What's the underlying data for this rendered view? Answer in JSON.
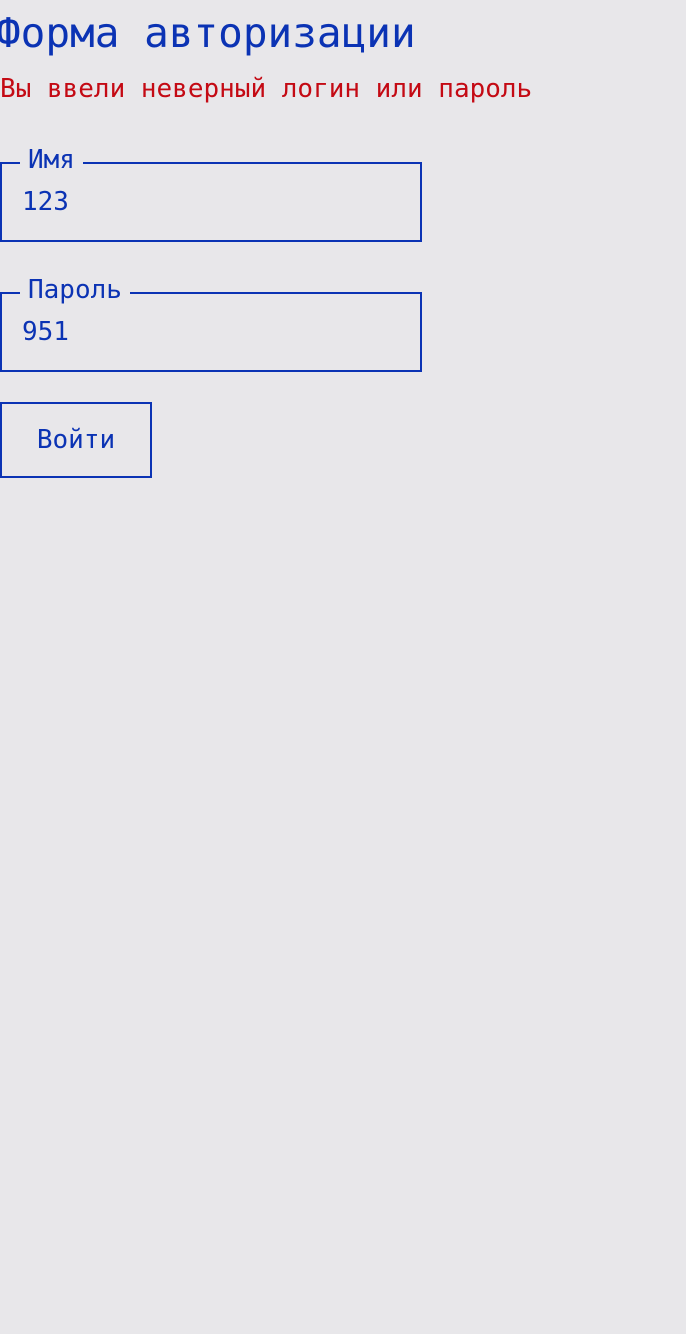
{
  "form": {
    "title": "Форма авторизации",
    "error_message": "Вы ввели неверный логин или пароль",
    "fields": {
      "name": {
        "label": "Имя",
        "value": "123"
      },
      "password": {
        "label": "Пароль",
        "value": "951"
      }
    },
    "submit_label": "Войти"
  },
  "colors": {
    "background": "#e8e7ea",
    "accent": "#0b33b4",
    "error": "#c40a14"
  }
}
